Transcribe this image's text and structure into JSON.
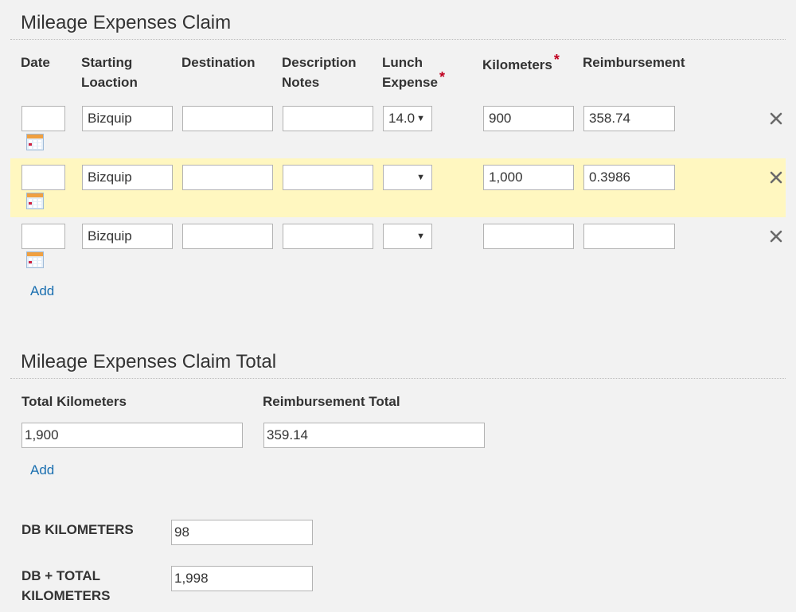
{
  "claim": {
    "title": "Mileage Expenses Claim",
    "columns": {
      "date": "Date",
      "start_line1": "Starting",
      "start_line2": "Loaction",
      "destination": "Destination",
      "desc_line1": "Description",
      "desc_line2": "Notes",
      "lunch_line1": "Lunch",
      "lunch_line2": "Expense",
      "kilometers": "Kilometers",
      "reimbursement": "Reimbursement",
      "required_mark": "*"
    },
    "rows": [
      {
        "date": "",
        "start": "Bizquip",
        "destination": "",
        "notes": "",
        "lunch": "14.0",
        "km": "900",
        "reimb": "358.74",
        "highlighted": false
      },
      {
        "date": "",
        "start": "Bizquip",
        "destination": "",
        "notes": "",
        "lunch": "",
        "km": "1,000",
        "reimb": "0.3986",
        "highlighted": true
      },
      {
        "date": "",
        "start": "Bizquip",
        "destination": "",
        "notes": "",
        "lunch": "",
        "km": "",
        "reimb": "",
        "highlighted": false
      }
    ],
    "add_label": "Add"
  },
  "total": {
    "title": "Mileage Expenses Claim Total",
    "total_km_label": "Total Kilometers",
    "reimb_total_label": "Reimbursement Total",
    "total_km": "1,900",
    "reimb_total": "359.14",
    "add_label": "Add"
  },
  "db": {
    "km_label": "DB KILOMETERS",
    "km_value": "98",
    "sum_label_line1": "DB + TOTAL",
    "sum_label_line2": "KILOMETERS",
    "sum_value": "1,998"
  },
  "colors": {
    "highlight_row": "#fff7c0",
    "link": "#1a6fb0",
    "required": "#c00020"
  },
  "icons": {
    "calendar": "calendar-icon",
    "delete": "close-icon",
    "dropdown": "chevron-down-icon"
  }
}
